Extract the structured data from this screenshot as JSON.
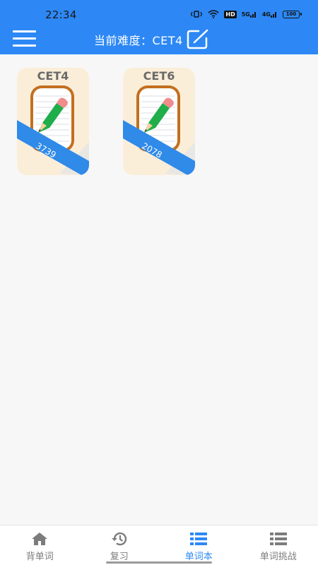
{
  "status_bar": {
    "time": "22:34",
    "hd_label": "HD",
    "signal_1": "5G",
    "signal_2": "4G",
    "battery": "100"
  },
  "header": {
    "title": "当前难度：CET4",
    "menu_icon": "hamburger-menu-icon",
    "edit_icon": "edit-icon"
  },
  "books": [
    {
      "name": "CET4",
      "count": "3739"
    },
    {
      "name": "CET6",
      "count": "2078"
    }
  ],
  "bottom_nav": [
    {
      "label": "背单词",
      "icon": "home-icon",
      "active": false
    },
    {
      "label": "复习",
      "icon": "history-icon",
      "active": false
    },
    {
      "label": "单词本",
      "icon": "list-icon",
      "active": true
    },
    {
      "label": "单词挑战",
      "icon": "list-icon",
      "active": false
    }
  ],
  "colors": {
    "primary": "#2d88f5",
    "book_bg": "#fbeed9",
    "book_frame": "#c36f1f",
    "ribbon": "#2f8ae8",
    "pencil_green": "#1fae4a",
    "inactive": "#7c7c7c"
  }
}
